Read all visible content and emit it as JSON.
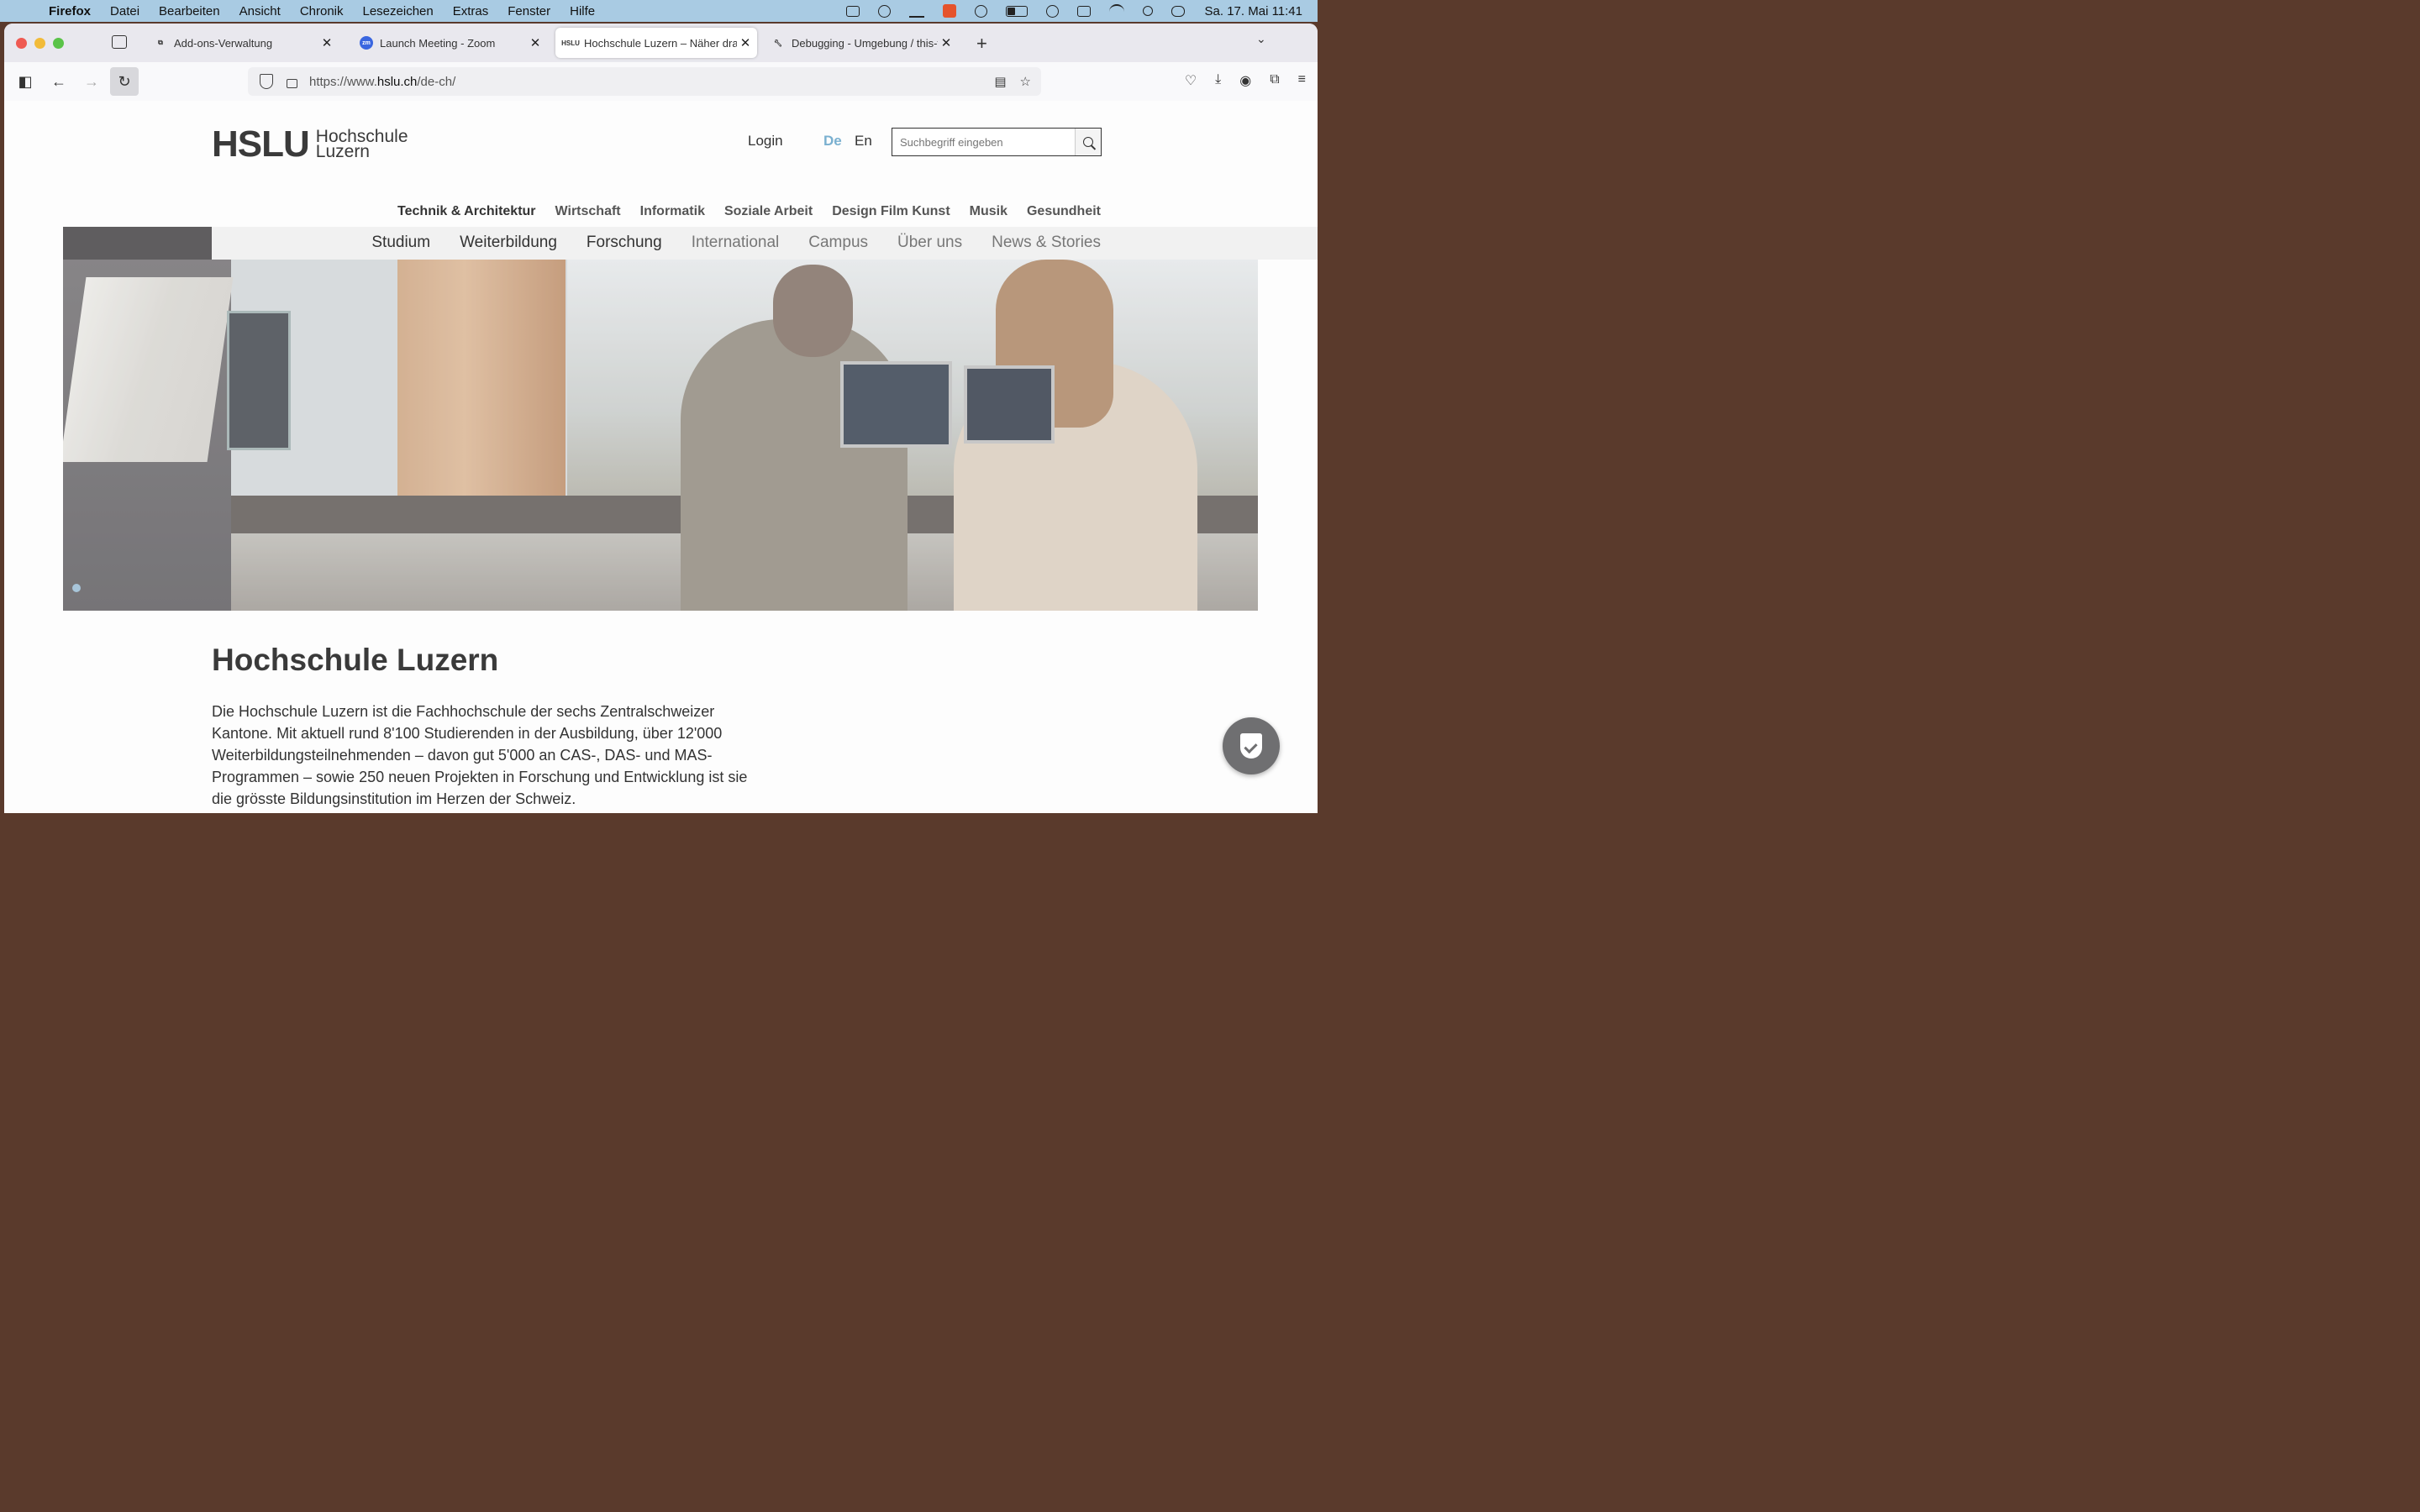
{
  "menubar": {
    "apple": "",
    "items": [
      "Firefox",
      "Datei",
      "Bearbeiten",
      "Ansicht",
      "Chronik",
      "Lesezeichen",
      "Extras",
      "Fenster",
      "Hilfe"
    ],
    "clock": "Sa. 17. Mai  11:41"
  },
  "tabs": [
    {
      "title": "Add-ons-Verwaltung",
      "icon": "puzzle-icon"
    },
    {
      "title": "Launch Meeting - Zoom",
      "icon": "zoom-icon",
      "favicon_text": "zm"
    },
    {
      "title": "Hochschule Luzern – Näher dran",
      "icon": "hslu-favicon",
      "favicon_text": "HSLU"
    },
    {
      "title": "Debugging - Umgebung / this-firefox",
      "icon": "wrench-icon"
    }
  ],
  "urlbar": {
    "prefix": "https://www.",
    "host": "hslu.ch",
    "path": "/de-ch/"
  },
  "site": {
    "logo_mark": "HSLU",
    "logo_line1": "Hochschule",
    "logo_line2": "Luzern",
    "login": "Login",
    "lang_de": "De",
    "lang_en": "En",
    "search_placeholder": "Suchbegriff eingeben",
    "departments": [
      "Technik & Architektur",
      "Wirtschaft",
      "Informatik",
      "Soziale Arbeit",
      "Design Film Kunst",
      "Musik",
      "Gesundheit"
    ],
    "main_nav": [
      "Studium",
      "Weiterbildung",
      "Forschung",
      "International",
      "Campus",
      "Über uns",
      "News & Stories"
    ],
    "heading": "Hochschule Luzern",
    "intro": "Die Hochschule Luzern ist die Fachhochschule der sechs Zentralschweizer Kantone. Mit aktuell rund 8'100 Studierenden in der Ausbildung, über 12'000 Weiterbildungsteilnehmenden – davon gut 5'000 an CAS-, DAS- und MAS-Programmen – sowie 250 neuen Projekten in Forschung und Entwicklung ist sie die grösste Bildungsinstitution im Herzen der Schweiz."
  },
  "colors": {
    "menubar": "#a9cbe3",
    "accent_lang": "#7ab0d0",
    "text_dark": "#3a3a3a"
  }
}
